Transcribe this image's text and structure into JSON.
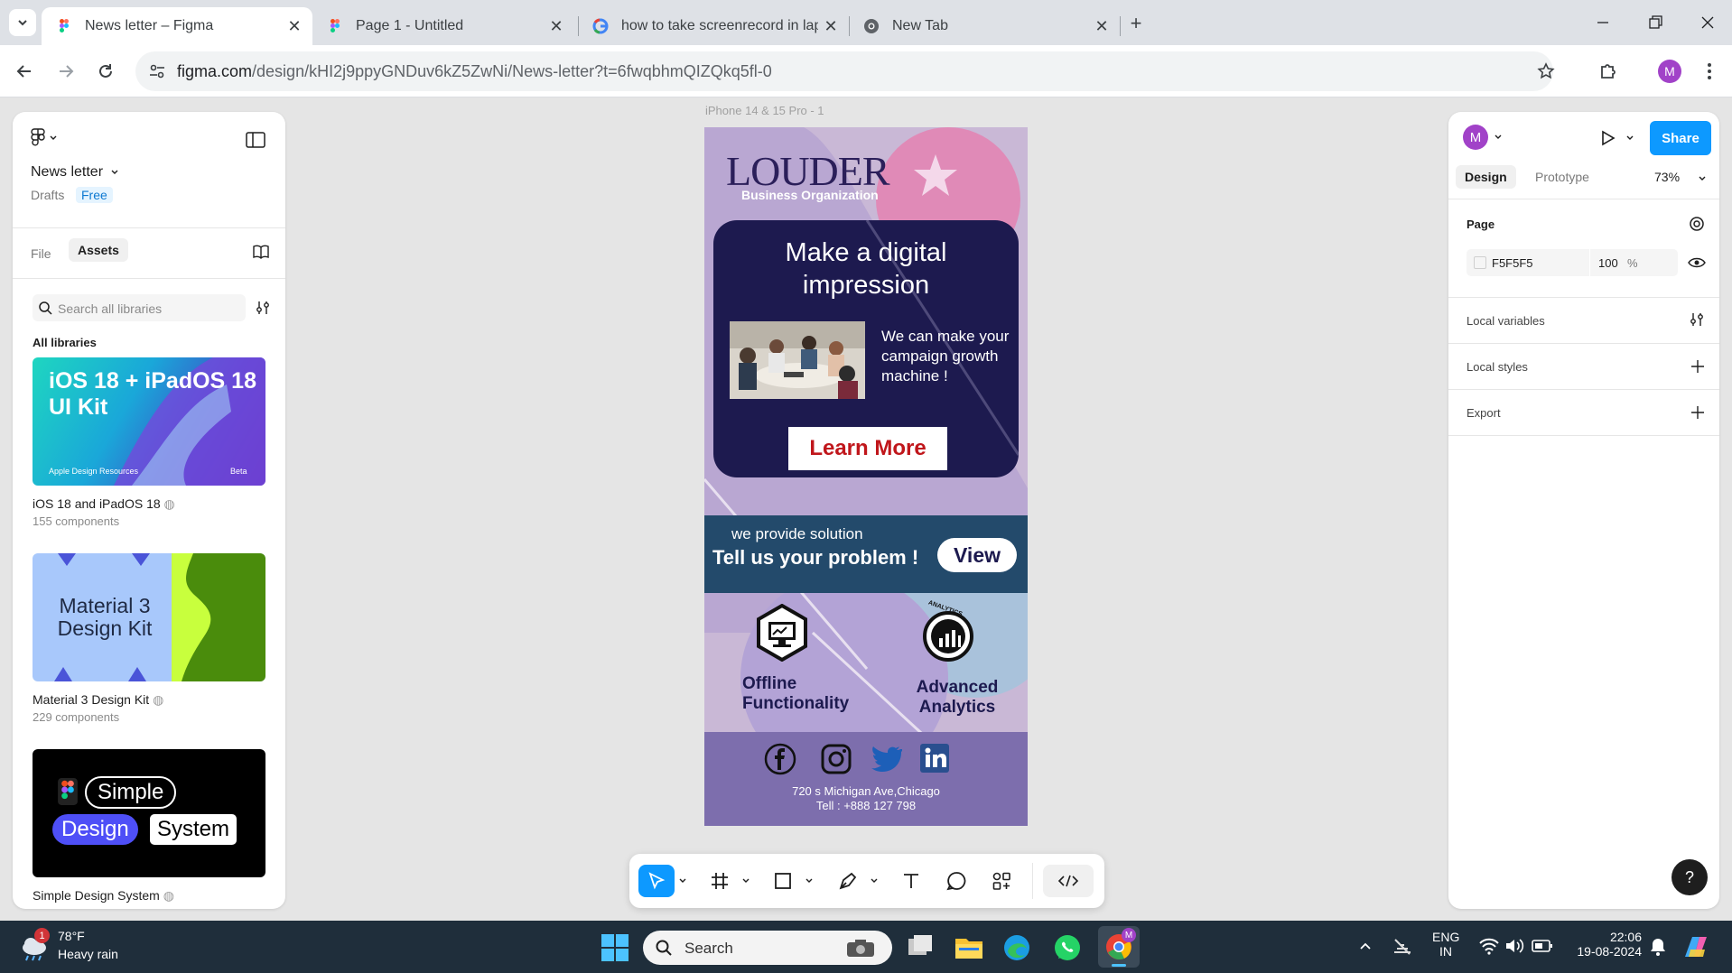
{
  "browser": {
    "tabs": [
      {
        "title": "News letter – Figma",
        "active": true
      },
      {
        "title": "Page 1 - Untitled",
        "active": false
      },
      {
        "title": "how to take screenrecord in lap",
        "active": false
      },
      {
        "title": "New Tab",
        "active": false
      }
    ],
    "url_host": "figma.com",
    "url_path": "/design/kHI2j9ppyGNDuv6kZ5ZwNi/News-letter?t=6fwqbhmQIZQkq5fl-0",
    "profile_initial": "M"
  },
  "left_panel": {
    "file_name": "News letter",
    "location": "Drafts",
    "plan_badge": "Free",
    "tabs": [
      "File",
      "Assets"
    ],
    "active_tab": "Assets",
    "search_placeholder": "Search all libraries",
    "section_title": "All libraries",
    "libraries": [
      {
        "name": "iOS 18 and iPadOS 18",
        "count": "155 components",
        "thumb_title": "iOS 18 + iPadOS 18 UI Kit",
        "thumb_footer": "Apple Design Resources",
        "thumb_tag": "Beta"
      },
      {
        "name": "Material 3 Design Kit",
        "count": "229 components",
        "thumb_title": "Material 3 Design Kit"
      },
      {
        "name": "Simple Design System",
        "count": "",
        "thumb_words": [
          "Simple",
          "Design",
          "System"
        ]
      }
    ]
  },
  "canvas": {
    "frame_label": "iPhone 14 & 15 Pro - 1",
    "newsletter": {
      "brand": "LOUDER",
      "brand_sub": "Business  Organization",
      "headline": "Make a digital impression",
      "body": "We can make your campaign growth machine !",
      "cta": "Learn More",
      "banner_small": "we provide solution",
      "banner_big": "Tell us your problem !",
      "banner_button": "View",
      "features": [
        "Offline Functionality",
        "Advanced Analytics"
      ],
      "analytics_badge": "ANALYTICS",
      "address": "720 s Michigan Ave,Chicago",
      "phone": "Tell : +888 127 798"
    }
  },
  "right_panel": {
    "user_initial": "M",
    "share_label": "Share",
    "tabs": [
      "Design",
      "Prototype"
    ],
    "active_tab": "Design",
    "zoom": "73%",
    "page_label": "Page",
    "page_color": "F5F5F5",
    "page_opacity": "100",
    "opacity_unit": "%",
    "sections": [
      "Local variables",
      "Local styles",
      "Export"
    ],
    "help": "?"
  },
  "taskbar": {
    "weather_temp": "78°F",
    "weather_desc": "Heavy rain",
    "weather_badge": "1",
    "search_label": "Search",
    "lang": "ENG",
    "region": "IN",
    "time": "22:06",
    "date": "19-08-2024"
  },
  "colors": {
    "figma_blue": "#0d99ff",
    "frame_bg": "#c9b8d6",
    "navy": "#1d1a4f",
    "banner": "#234a6b",
    "footer": "#7d6ead",
    "cta_red": "#c0161b"
  }
}
